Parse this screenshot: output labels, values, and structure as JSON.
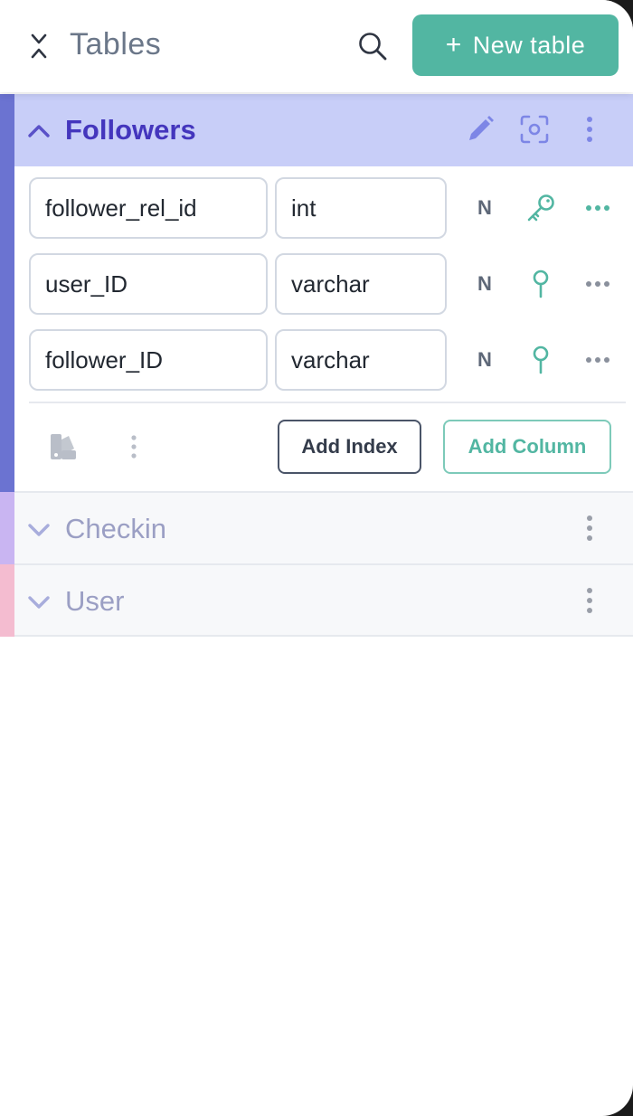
{
  "header": {
    "title": "Tables",
    "new_table_label": "New table",
    "plus": "+",
    "accent_color": "#52b6a2"
  },
  "tables": [
    {
      "name": "Followers",
      "expanded": true,
      "color": "#6b73d1",
      "columns": [
        {
          "name": "follower_rel_id",
          "type": "int",
          "nullable": "N",
          "key": "primary-key-icon"
        },
        {
          "name": "user_ID",
          "type": "varchar",
          "nullable": "N",
          "key": "foreign-key-icon"
        },
        {
          "name": "follower_ID",
          "type": "varchar",
          "nullable": "N",
          "key": "foreign-key-icon"
        }
      ],
      "add_index_label": "Add Index",
      "add_column_label": "Add Column"
    },
    {
      "name": "Checkin",
      "expanded": false,
      "color": "#c9b5f2"
    },
    {
      "name": "User",
      "expanded": false,
      "color": "#f4bcd0"
    }
  ]
}
